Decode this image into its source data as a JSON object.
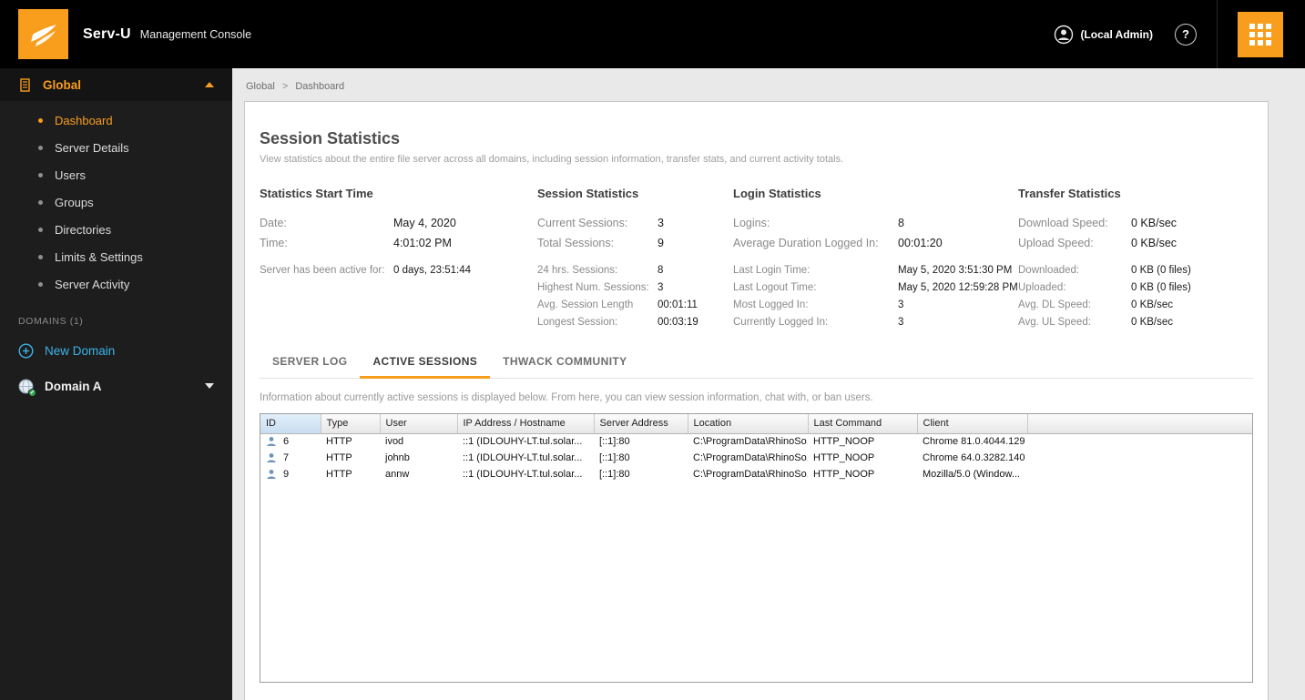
{
  "theme": {
    "accent_orange": "#f99d1c",
    "link_blue": "#3cb4e7",
    "sidebar_bg": "#1d1d1d",
    "topbar_bg": "#000000",
    "sorted_header_blue": "#cfe2f4",
    "status_green": "#2fa84f"
  },
  "header": {
    "brand": "Serv-U",
    "product": "Management Console",
    "account_label": "(Local Admin)",
    "help_label": "?"
  },
  "sidebar": {
    "global_label": "Global",
    "items": [
      {
        "label": "Dashboard"
      },
      {
        "label": "Server Details"
      },
      {
        "label": "Users"
      },
      {
        "label": "Groups"
      },
      {
        "label": "Directories"
      },
      {
        "label": "Limits & Settings"
      },
      {
        "label": "Server Activity"
      }
    ],
    "domains_heading": "DOMAINS (1)",
    "new_domain_label": "New Domain",
    "domain_label": "Domain A"
  },
  "breadcrumb": {
    "root": "Global",
    "separator": ">",
    "current": "Dashboard"
  },
  "panel": {
    "title": "Session Statistics",
    "description": "View statistics about the entire file server across all domains, including session information, transfer stats, and current activity totals.",
    "stats_columns": [
      {
        "title": "Statistics Start Time",
        "primary": [
          {
            "label": "Date:",
            "value": "May 4, 2020"
          },
          {
            "label": "Time:",
            "value": "4:01:02 PM"
          }
        ],
        "secondary": [
          {
            "label": "Server has been active for:",
            "value": "0 days, 23:51:44"
          }
        ]
      },
      {
        "title": "Session Statistics",
        "primary": [
          {
            "label": "Current Sessions:",
            "value": "3"
          },
          {
            "label": "Total Sessions:",
            "value": "9"
          }
        ],
        "secondary": [
          {
            "label": "24 hrs. Sessions:",
            "value": "8"
          },
          {
            "label": "Highest Num. Sessions:",
            "value": "3"
          },
          {
            "label": "Avg. Session Length",
            "value": "00:01:11"
          },
          {
            "label": "Longest Session:",
            "value": "00:03:19"
          }
        ]
      },
      {
        "title": "Login Statistics",
        "primary": [
          {
            "label": "Logins:",
            "value": "8"
          },
          {
            "label": "Average Duration Logged In:",
            "value": "00:01:20"
          }
        ],
        "secondary": [
          {
            "label": "Last Login Time:",
            "value": "May 5, 2020 3:51:30 PM"
          },
          {
            "label": "Last Logout Time:",
            "value": "May 5, 2020 12:59:28 PM"
          },
          {
            "label": "Most Logged In:",
            "value": "3"
          },
          {
            "label": "Currently Logged In:",
            "value": "3"
          }
        ]
      },
      {
        "title": "Transfer Statistics",
        "primary": [
          {
            "label": "Download Speed:",
            "value": "0 KB/sec"
          },
          {
            "label": "Upload Speed:",
            "value": "0 KB/sec"
          }
        ],
        "secondary": [
          {
            "label": "Downloaded:",
            "value": "0 KB (0 files)"
          },
          {
            "label": "Uploaded:",
            "value": "0 KB (0 files)"
          },
          {
            "label": "Avg. DL Speed:",
            "value": "0 KB/sec"
          },
          {
            "label": "Avg. UL Speed:",
            "value": "0 KB/sec"
          }
        ]
      }
    ]
  },
  "tabs": [
    {
      "label": "SERVER LOG"
    },
    {
      "label": "ACTIVE SESSIONS"
    },
    {
      "label": "THWACK COMMUNITY"
    }
  ],
  "sessions": {
    "description": "Information about currently active sessions is displayed below. From here, you can view session information, chat with, or ban users.",
    "table": {
      "columns": [
        "ID",
        "Type",
        "User",
        "IP Address / Hostname",
        "Server Address",
        "Location",
        "Last Command",
        "Client"
      ],
      "rows": [
        {
          "id": "6",
          "type": "HTTP",
          "user": "ivod",
          "ip": "::1 (IDLOUHY-LT.tul.solar...",
          "server": "[::1]:80",
          "location": "C:\\ProgramData\\RhinoSo...",
          "command": "HTTP_NOOP",
          "client": "Chrome 81.0.4044.129"
        },
        {
          "id": "7",
          "type": "HTTP",
          "user": "johnb",
          "ip": "::1 (IDLOUHY-LT.tul.solar...",
          "server": "[::1]:80",
          "location": "C:\\ProgramData\\RhinoSo...",
          "command": "HTTP_NOOP",
          "client": "Chrome 64.0.3282.140"
        },
        {
          "id": "9",
          "type": "HTTP",
          "user": "annw",
          "ip": "::1 (IDLOUHY-LT.tul.solar...",
          "server": "[::1]:80",
          "location": "C:\\ProgramData\\RhinoSo...",
          "command": "HTTP_NOOP",
          "client": "Mozilla/5.0 (Window..."
        }
      ]
    }
  }
}
